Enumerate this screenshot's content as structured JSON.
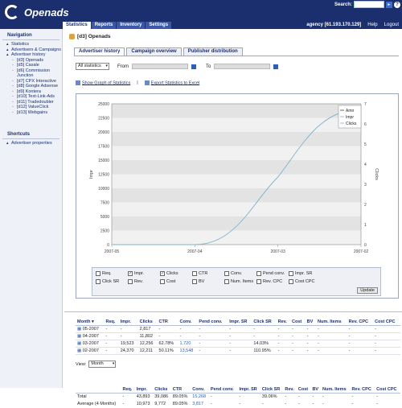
{
  "app": {
    "title": "Openads"
  },
  "search": {
    "label": "Search:",
    "go": "►"
  },
  "tabs": [
    "Statistics",
    "Reports",
    "Inventory",
    "Settings"
  ],
  "agency": {
    "text": "agency [61.193.170.129]",
    "help": "Help",
    "logout": "Logout"
  },
  "sidebar": {
    "nav_title": "Navigation",
    "items": [
      "Statistics",
      "Advertisers & Campaigns",
      "Advertiser history"
    ],
    "subitems": [
      "[d3] Openads",
      "[d5] Casale",
      "[d6] Commission Junction",
      "[d7] CPX Interactive",
      "[d8] Google Adsense",
      "[d9] Kontera",
      "[d10] Text-Link-Ads",
      "[d11] Tradedoubler",
      "[d12] ValueClick",
      "[d13] Webgains"
    ],
    "shortcuts_title": "Shortcuts",
    "shortcut": "Advertiser properties"
  },
  "breadcrumb": "[d3] Openads",
  "subtabs": [
    "Advertiser history",
    "Campaign overview",
    "Publisher distribution"
  ],
  "filters": {
    "period": "All statistics",
    "from": "From",
    "to": "To"
  },
  "links": {
    "graph": "Show Graph of Statistics",
    "export": "Export Statistics to Excel"
  },
  "chart_data": {
    "type": "line",
    "x": [
      "2007-05",
      "2007-04",
      "2007-03",
      "2007-02"
    ],
    "series": [
      {
        "name": "Impr",
        "values": [
          0,
          0,
          12000,
          24000
        ]
      }
    ],
    "ylabel": "Impr",
    "y2label": "Clicks",
    "ylim": [
      0,
      25000
    ],
    "yticks": [
      "25000",
      "22500",
      "20000",
      "17500",
      "15000",
      "12500",
      "10000",
      "7500",
      "5000",
      "2500",
      "0"
    ],
    "y2ticks": [
      "7",
      "6",
      "5",
      "4",
      "3",
      "2",
      "1",
      "0"
    ],
    "legend": [
      "Amir",
      "Impr",
      "Clicks"
    ],
    "line_color": "#7fb2c8"
  },
  "checkboxes": [
    {
      "label": "Req.",
      "checked": false
    },
    {
      "label": "Impr.",
      "checked": true
    },
    {
      "label": "Clicks",
      "checked": true
    },
    {
      "label": "CTR",
      "checked": false
    },
    {
      "label": "Conv.",
      "checked": false
    },
    {
      "label": "Pend conv.",
      "checked": false
    },
    {
      "label": "Impr. SR",
      "checked": false
    },
    {
      "label": "Click SR",
      "checked": false
    },
    {
      "label": "Rev.",
      "checked": false
    },
    {
      "label": "Cost",
      "checked": false
    },
    {
      "label": "BV",
      "checked": false
    },
    {
      "label": "Num. Items",
      "checked": false
    },
    {
      "label": "Rev. CPC",
      "checked": false
    },
    {
      "label": "Cost CPC",
      "checked": false
    }
  ],
  "update_label": "Update",
  "table": {
    "headers": [
      "Month ▾",
      "Req.",
      "Impr.",
      "Clicks",
      "CTR",
      "Conv.",
      "Pend conv.",
      "Impr. SR",
      "Click SR",
      "Rev.",
      "Cost",
      "BV",
      "Num. Items",
      "Rev. CPC",
      "Cost CPC"
    ],
    "rows": [
      [
        "05-2007",
        "-",
        "-",
        "2,817",
        "-",
        "-",
        "-",
        "-",
        "-",
        "-",
        "-",
        "-",
        "-",
        "-",
        "-"
      ],
      [
        "04-2007",
        "-",
        "-",
        "11,802",
        "-",
        "-",
        "-",
        "-",
        "-",
        "-",
        "-",
        "-",
        "-",
        "-",
        "-"
      ],
      [
        "03-2007",
        "-",
        "19,523",
        "12,256",
        "62.78%",
        "1,720",
        "-",
        "-",
        "14.03%",
        "-",
        "-",
        "-",
        "-",
        "-",
        "-"
      ],
      [
        "02-2007",
        "-",
        "24,370",
        "12,211",
        "50.11%",
        "13,548",
        "-",
        "-",
        "110.95%",
        "-",
        "-",
        "-",
        "-",
        "-",
        "-"
      ]
    ]
  },
  "view": {
    "label": "View:",
    "value": "Month"
  },
  "totals": {
    "headers": [
      "",
      "Req.",
      "Impr.",
      "Clicks",
      "CTR",
      "Conv.",
      "Pend conv.",
      "Impr. SR",
      "Click SR",
      "Rev.",
      "Cost",
      "BV",
      "Num. Items",
      "Rev. CPC",
      "Cost CPC"
    ],
    "rows": [
      [
        "Total",
        "-",
        "43,893",
        "39,086",
        "89.05%",
        "15,268",
        "-",
        "-",
        "39.06%",
        "-",
        "-",
        "-",
        "-",
        "-",
        "-"
      ],
      [
        "Average (4 Months)",
        "-",
        "10,973",
        "9,772",
        "89.05%",
        "3,817",
        "-",
        "-",
        "-",
        "-",
        "-",
        "-",
        "-",
        "-",
        "-"
      ]
    ]
  }
}
